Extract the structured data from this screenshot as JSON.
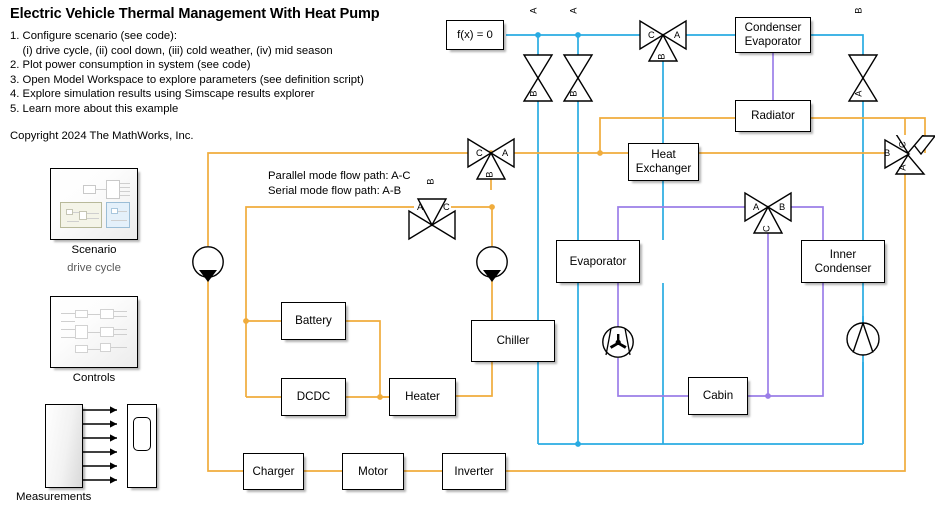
{
  "header": {
    "title": "Electric Vehicle Thermal Management With Heat Pump",
    "steps": "1. Configure scenario (see code):\n    (i) drive cycle, (ii) cool down, (iii) cold weather, (iv) mid season\n2. Plot power consumption in system (see code)\n3. Open Model Workspace to explore parameters (see definition script)\n4. Explore simulation results using Simscape results explorer\n5. Learn more about this example",
    "copyright": "Copyright 2024 The MathWorks, Inc."
  },
  "annotations": {
    "flow_paths": "Parallel mode flow path: A-C\nSerial mode flow path: A-B"
  },
  "solver": {
    "label": "f(x) = 0"
  },
  "subsystems": [
    {
      "name": "scenario",
      "label": "Scenario",
      "sublabel": "drive cycle"
    },
    {
      "name": "controls",
      "label": "Controls",
      "sublabel": ""
    },
    {
      "name": "measurements",
      "label": "Measurements",
      "sublabel": ""
    }
  ],
  "blocks": {
    "condenser_evaporator": "Condenser\nEvaporator",
    "radiator": "Radiator",
    "heat_exchanger": "Heat\nExchanger",
    "evaporator": "Evaporator",
    "inner_condenser": "Inner\nCondenser",
    "cabin": "Cabin",
    "chiller": "Chiller",
    "battery": "Battery",
    "dcdc": "DCDC",
    "heater": "Heater",
    "charger": "Charger",
    "motor": "Motor",
    "inverter": "Inverter"
  },
  "valves": {
    "tw_left_top": {
      "ports": [
        "A",
        "B"
      ]
    },
    "tw_left_top2": {
      "ports": [
        "A",
        "B"
      ]
    },
    "tw_right_top": {
      "ports": [
        "B",
        "A"
      ]
    },
    "threeway_upper": {
      "ports": [
        "C",
        "A",
        "B"
      ]
    },
    "threeway_lower": {
      "ports": [
        "A",
        "C",
        "B"
      ]
    },
    "threeway_right": {
      "ports": [
        "B",
        "C",
        "A"
      ]
    },
    "threeway_air": {
      "ports": [
        "A",
        "B",
        "C"
      ]
    }
  },
  "colors": {
    "refrigerant": "#29abe2",
    "coolant": "#f0ac3c",
    "moist_air": "#9b7ee8",
    "block_border": "#000000",
    "background": "#ffffff"
  }
}
